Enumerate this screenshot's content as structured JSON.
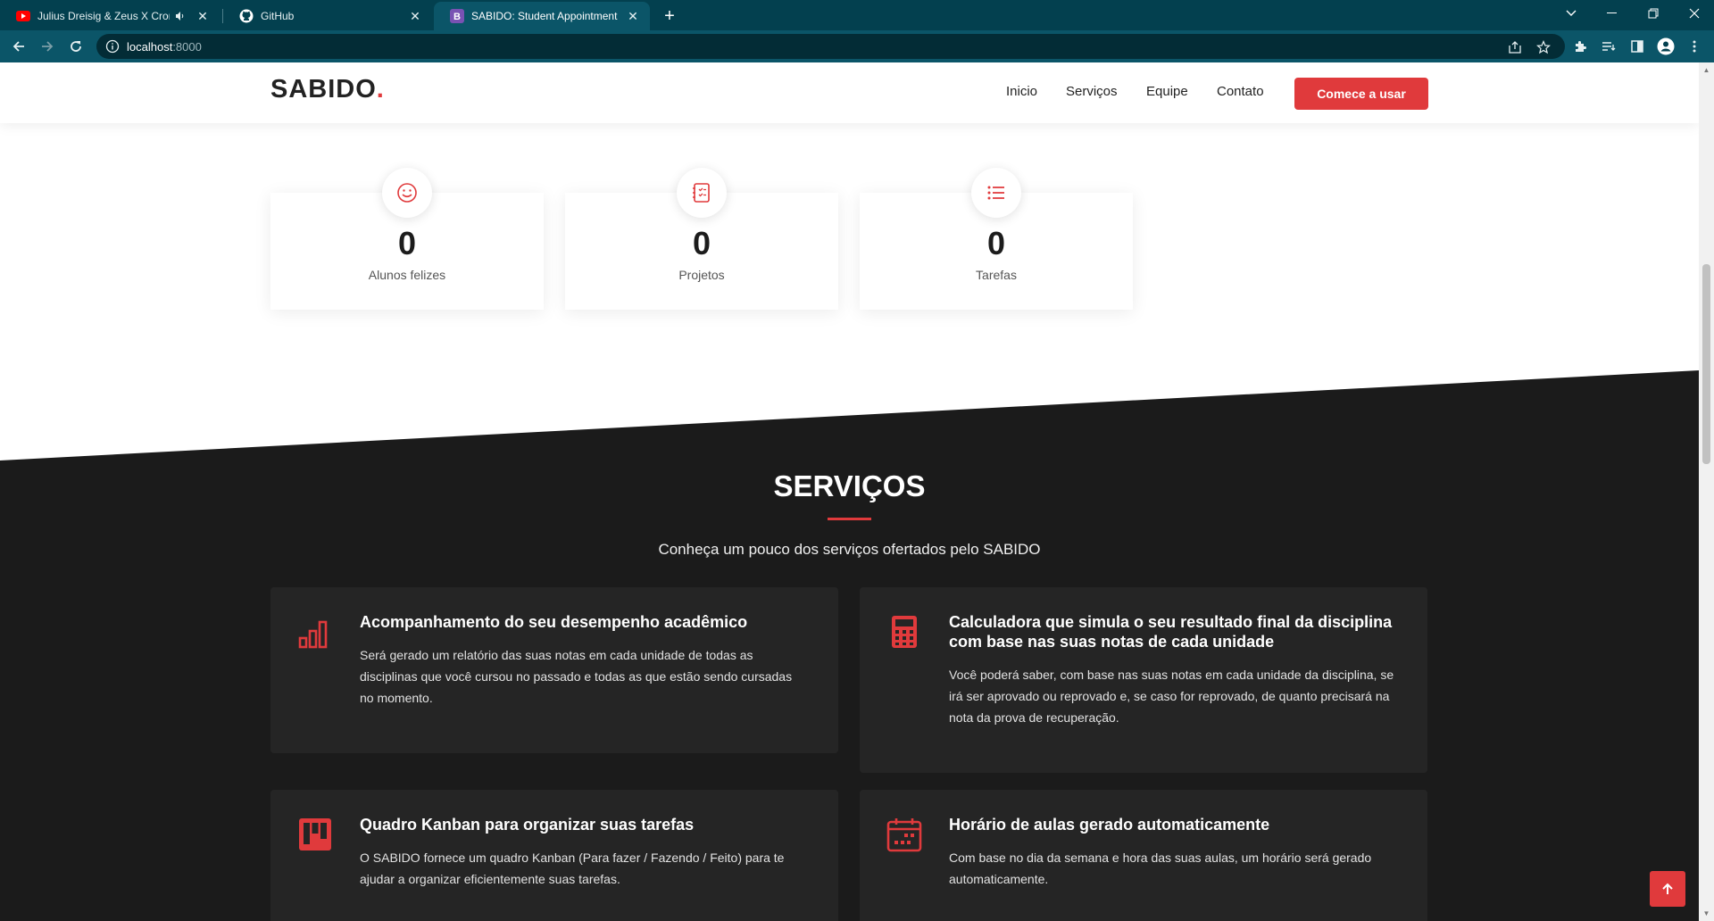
{
  "browser": {
    "tabs": [
      {
        "title": "Julius Dreisig & Zeus X Crona",
        "favicon": "youtube-icon",
        "audio": true
      },
      {
        "title": "GitHub",
        "favicon": "github-icon"
      },
      {
        "title": "SABIDO: Student Appointment B",
        "favicon": "bootstrap-icon",
        "favicon_letter": "B",
        "active": true
      }
    ],
    "url_host": "localhost",
    "url_port": ":8000"
  },
  "site": {
    "logo": "SABIDO",
    "logo_dot": ".",
    "nav": [
      "Inicio",
      "Serviços",
      "Equipe",
      "Contato"
    ],
    "cta": "Comece a usar",
    "accent": "#e03a3c"
  },
  "counters": [
    {
      "value": "0",
      "label": "Alunos felizes",
      "icon": "smiley-icon"
    },
    {
      "value": "0",
      "label": "Projetos",
      "icon": "journal-icon"
    },
    {
      "value": "0",
      "label": "Tarefas",
      "icon": "list-icon"
    }
  ],
  "services": {
    "title": "SERVIÇOS",
    "subtitle": "Conheça um pouco dos serviços ofertados pelo SABIDO",
    "items": [
      {
        "title": "Acompanhamento do seu desempenho acadêmico",
        "desc": "Será gerado um relatório das suas notas em cada unidade de todas as disciplinas que você cursou no passado e todas as que estão sendo cursadas no momento.",
        "icon": "bar-chart-icon"
      },
      {
        "title": "Calculadora que simula o seu resultado final da disciplina com base nas suas notas de cada unidade",
        "desc": "Você poderá saber, com base nas suas notas em cada unidade da disciplina, se irá ser aprovado ou reprovado e, se caso for reprovado, de quanto precisará na nota da prova de recuperação.",
        "icon": "calculator-icon"
      },
      {
        "title": "Quadro Kanban para organizar suas tarefas",
        "desc": "O SABIDO fornece um quadro Kanban (Para fazer / Fazendo / Feito) para te ajudar a organizar eficientemente suas tarefas.",
        "icon": "kanban-icon"
      },
      {
        "title": "Horário de aulas gerado automaticamente",
        "desc": "Com base no dia da semana e hora das suas aulas, um horário será gerado automaticamente.",
        "icon": "calendar-icon"
      }
    ]
  }
}
